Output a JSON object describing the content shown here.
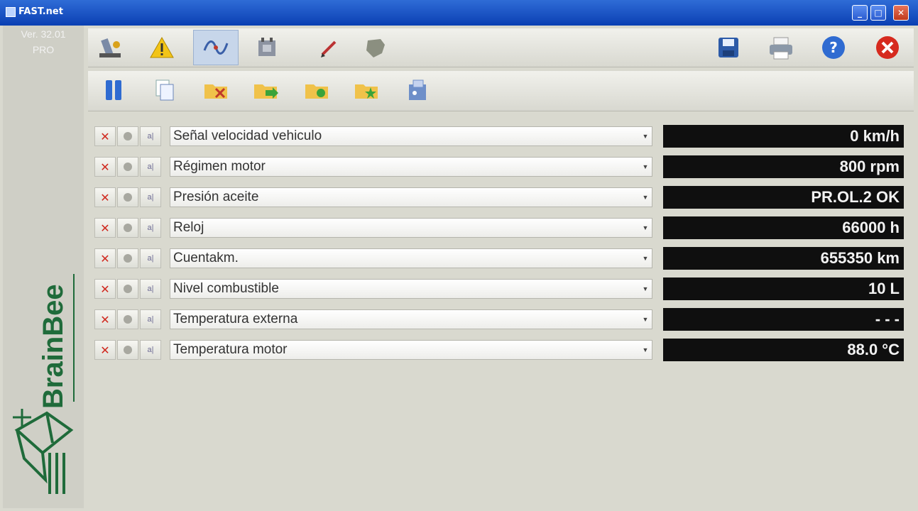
{
  "window": {
    "title": "FAST.net",
    "buttons": {
      "minimize": "_",
      "maximize": "□",
      "close": "✕"
    }
  },
  "left_panel": {
    "version_line1": "Ver. 32.01",
    "version_line2": "PRO",
    "logo_text": "BrainBee"
  },
  "toolbar_main": {
    "icons": [
      "car-lift-icon",
      "warning-icon",
      "signal-wave-icon",
      "engine-icon",
      "pen-icon",
      "map-icon",
      "save-icon",
      "print-icon",
      "help-icon",
      "close-icon"
    ]
  },
  "toolbar_secondary": {
    "icons": [
      "pause-icon",
      "copy-icon",
      "folder-delete-icon",
      "folder-forward-icon",
      "folder-open-icon",
      "folder-star-icon",
      "settings-box-icon"
    ]
  },
  "parameters": [
    {
      "label": "Señal velocidad vehiculo",
      "value": "0 km/h"
    },
    {
      "label": "Régimen motor",
      "value": "800 rpm"
    },
    {
      "label": "Presión aceite",
      "value": "PR.OL.2 OK"
    },
    {
      "label": "Reloj",
      "value": "66000 h"
    },
    {
      "label": "Cuentakm.",
      "value": "655350 km"
    },
    {
      "label": "Nivel combustible",
      "value": "10 L"
    },
    {
      "label": "Temperatura externa",
      "value": "- - -"
    },
    {
      "label": "Temperatura motor",
      "value": "88.0 °C"
    }
  ],
  "row_buttons": {
    "remove": "✕",
    "scale": "a|"
  },
  "colors": {
    "accent": "#0a3fb3",
    "value_bg": "#0f0f0f",
    "value_text": "#f2f2f2",
    "logo": "#1f6b3a"
  }
}
